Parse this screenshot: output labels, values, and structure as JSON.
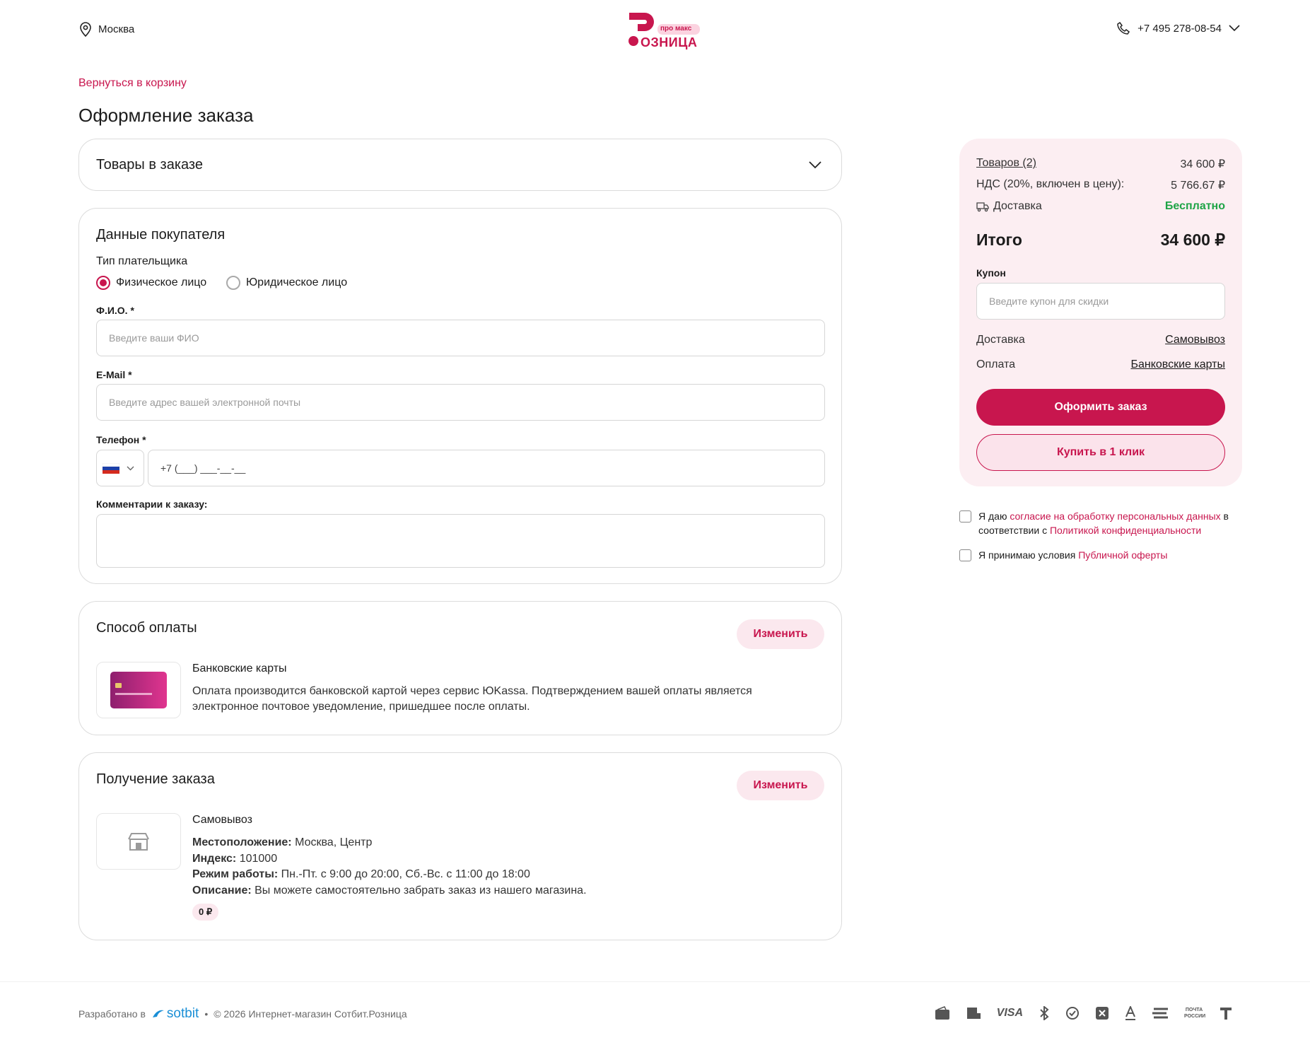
{
  "header": {
    "city": "Москва",
    "logo_top": "про макс",
    "logo_main": "ОЗНИЦА",
    "phone": "+7 495 278-08-54"
  },
  "back_link": "Вернуться в корзину",
  "page_title": "Оформление заказа",
  "items_section": {
    "title": "Товары в заказе"
  },
  "buyer": {
    "title": "Данные покупателя",
    "payer_type_label": "Тип плательщика",
    "payer_types": [
      "Физическое лицо",
      "Юридическое лицо"
    ],
    "fio_label": "Ф.И.О. *",
    "fio_placeholder": "Введите ваши ФИО",
    "email_label": "E-Mail *",
    "email_placeholder": "Введите адрес вашей электронной почты",
    "phone_label": "Телефон *",
    "phone_placeholder": "+7 (___) ___-__-__",
    "comment_label": "Комментарии к заказу:"
  },
  "payment": {
    "title": "Способ оплаты",
    "change_label": "Изменить",
    "method_name": "Банковские карты",
    "method_desc": "Оплата производится банковской картой через сервис ЮKassa. Подтверждением вашей оплаты является электронное почтовое уведомление, пришедшее после оплаты."
  },
  "delivery": {
    "title": "Получение заказа",
    "change_label": "Изменить",
    "method_name": "Самовывоз",
    "location_label": "Местоположение:",
    "location_value": "Москва, Центр",
    "index_label": "Индекс:",
    "index_value": "101000",
    "hours_label": "Режим работы:",
    "hours_value": "Пн.-Пт. с 9:00 до 20:00, Сб.-Вс. с 11:00 до 18:00",
    "desc_label": "Описание:",
    "desc_value": "Вы можете самостоятельно забрать заказ из нашего магазина.",
    "price_badge": "0 ₽"
  },
  "summary": {
    "items_label": "Товаров (2)",
    "items_value": "34 600 ₽",
    "vat_label": "НДС (20%, включен в цену):",
    "vat_value": "5 766.67 ₽",
    "delivery_label": "Доставка",
    "delivery_value": "Бесплатно",
    "total_label": "Итого",
    "total_value": "34 600 ₽",
    "coupon_label": "Купон",
    "coupon_placeholder": "Введите купон для скидки",
    "delivery_method_label": "Доставка",
    "delivery_method_value": "Самовывоз",
    "payment_method_label": "Оплата",
    "payment_method_value": "Банковские карты",
    "checkout_button": "Оформить заказ",
    "oneclick_button": "Купить в 1 клик"
  },
  "consent": {
    "c1_pre": "Я даю ",
    "c1_link": "согласие на обработку персональных данных",
    "c1_mid": " в соответствии с ",
    "c1_link2": "Политикой конфиденциальности",
    "c2_pre": "Я принимаю условия ",
    "c2_link": "Публичной оферты"
  },
  "footer": {
    "dev_label": "Разработано в",
    "dev_brand": "sotbit",
    "dot": "•",
    "copyright": "© 2026 Интернет-магазин Сотбит.Розница",
    "pay_visa": "VISA",
    "pay_post": "ПОЧТА РОССИИ"
  },
  "colors": {
    "accent": "#c8164e",
    "summary_bg": "#fceef2",
    "free": "#1ea446"
  }
}
